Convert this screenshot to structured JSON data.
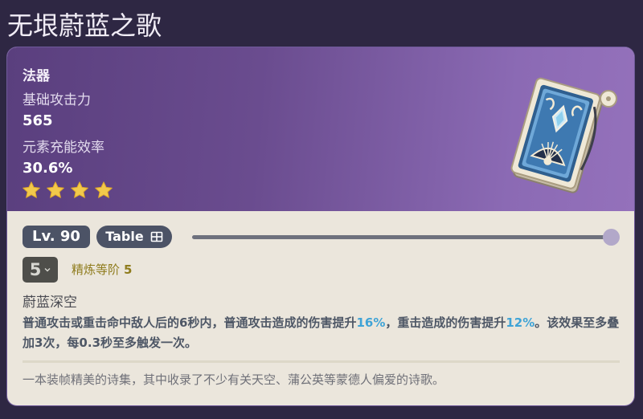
{
  "page": {
    "title": "无垠蔚蓝之歌"
  },
  "weapon": {
    "type": "法器",
    "base_atk_label": "基础攻击力",
    "base_atk_value": "565",
    "substat_label": "元素充能效率",
    "substat_value": "30.6%",
    "rarity_stars": 4,
    "art_icon": "book-catalyst-icon"
  },
  "controls": {
    "level_label": "Lv. 90",
    "table_button_label": "Table",
    "table_icon": "table-icon",
    "level_slider_fraction": 1.0,
    "refinement_select_value": "5",
    "refinement_label": "精炼等阶",
    "refinement_level": "5"
  },
  "passive": {
    "name": "蔚蓝深空",
    "desc_part1": "普通攻击或重击命中敌人后的6秒内，普通攻击造成的伤害提升",
    "desc_hl1": "16%",
    "desc_part2": "，重击造成的伤害提升",
    "desc_hl2": "12%",
    "desc_part3": "。该效果至多叠加3次，每0.3秒至多触发一次。"
  },
  "lore": {
    "text": "一本装帧精美的诗集，其中收录了不少有关天空、蒲公英等蒙德人偏爱的诗歌。"
  },
  "colors": {
    "star": "#f2c94c",
    "highlight": "#3fa3d6",
    "refine_label": "#8f7c1d",
    "header_gradient_start": "#5a3f7e",
    "header_gradient_end": "#9471bb",
    "badge_bg": "#4c5366",
    "slider_thumb": "#b2a8c9"
  }
}
